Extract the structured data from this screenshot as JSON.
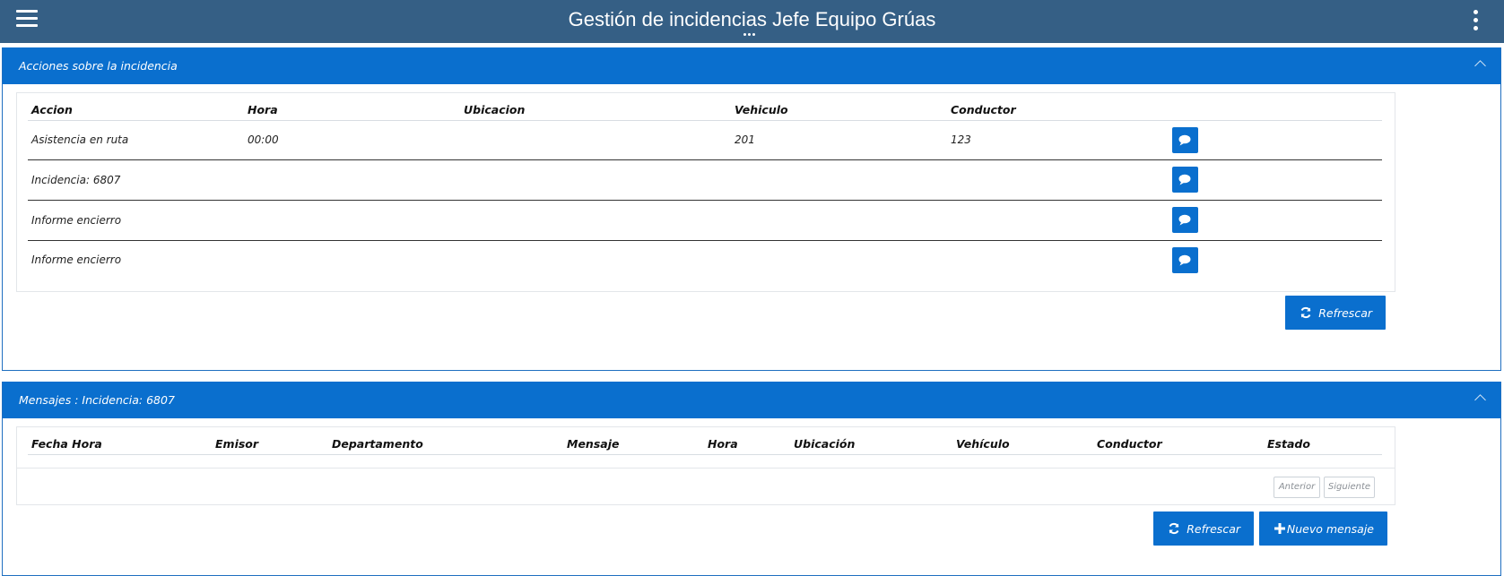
{
  "header": {
    "title": "Gestión de incidencias Jefe Equipo Grúas",
    "menu_icon": "hamburger-icon",
    "more_icon": "kebab-icon"
  },
  "acciones": {
    "title": "Acciones sobre la incidencia",
    "columns": [
      "Accion",
      "Hora",
      "Ubicacion",
      "Vehiculo",
      "Conductor"
    ],
    "rows": [
      {
        "accion": "Asistencia en ruta",
        "hora": "00:00",
        "ubicacion": "",
        "vehiculo": "201",
        "conductor": "123"
      },
      {
        "accion": "Incidencia: 6807",
        "hora": "",
        "ubicacion": "",
        "vehiculo": "",
        "conductor": ""
      },
      {
        "accion": "Informe encierro",
        "hora": "",
        "ubicacion": "",
        "vehiculo": "",
        "conductor": ""
      },
      {
        "accion": "Informe encierro",
        "hora": "",
        "ubicacion": "",
        "vehiculo": "",
        "conductor": ""
      }
    ],
    "refresh_label": "Refrescar"
  },
  "mensajes": {
    "title": "Mensajes : Incidencia: 6807",
    "columns": [
      "Fecha Hora",
      "Emisor",
      "Departamento",
      "Mensaje",
      "Hora",
      "Ubicación",
      "Vehículo",
      "Conductor",
      "Estado"
    ],
    "prev_label": "Anterior",
    "next_label": "Siguiente",
    "refresh_label": "Refrescar",
    "new_message_label": "Nuevo mensaje"
  },
  "colors": {
    "topbar": "#355f85",
    "panel_header": "#0a6fce",
    "button": "#0a6fce"
  }
}
